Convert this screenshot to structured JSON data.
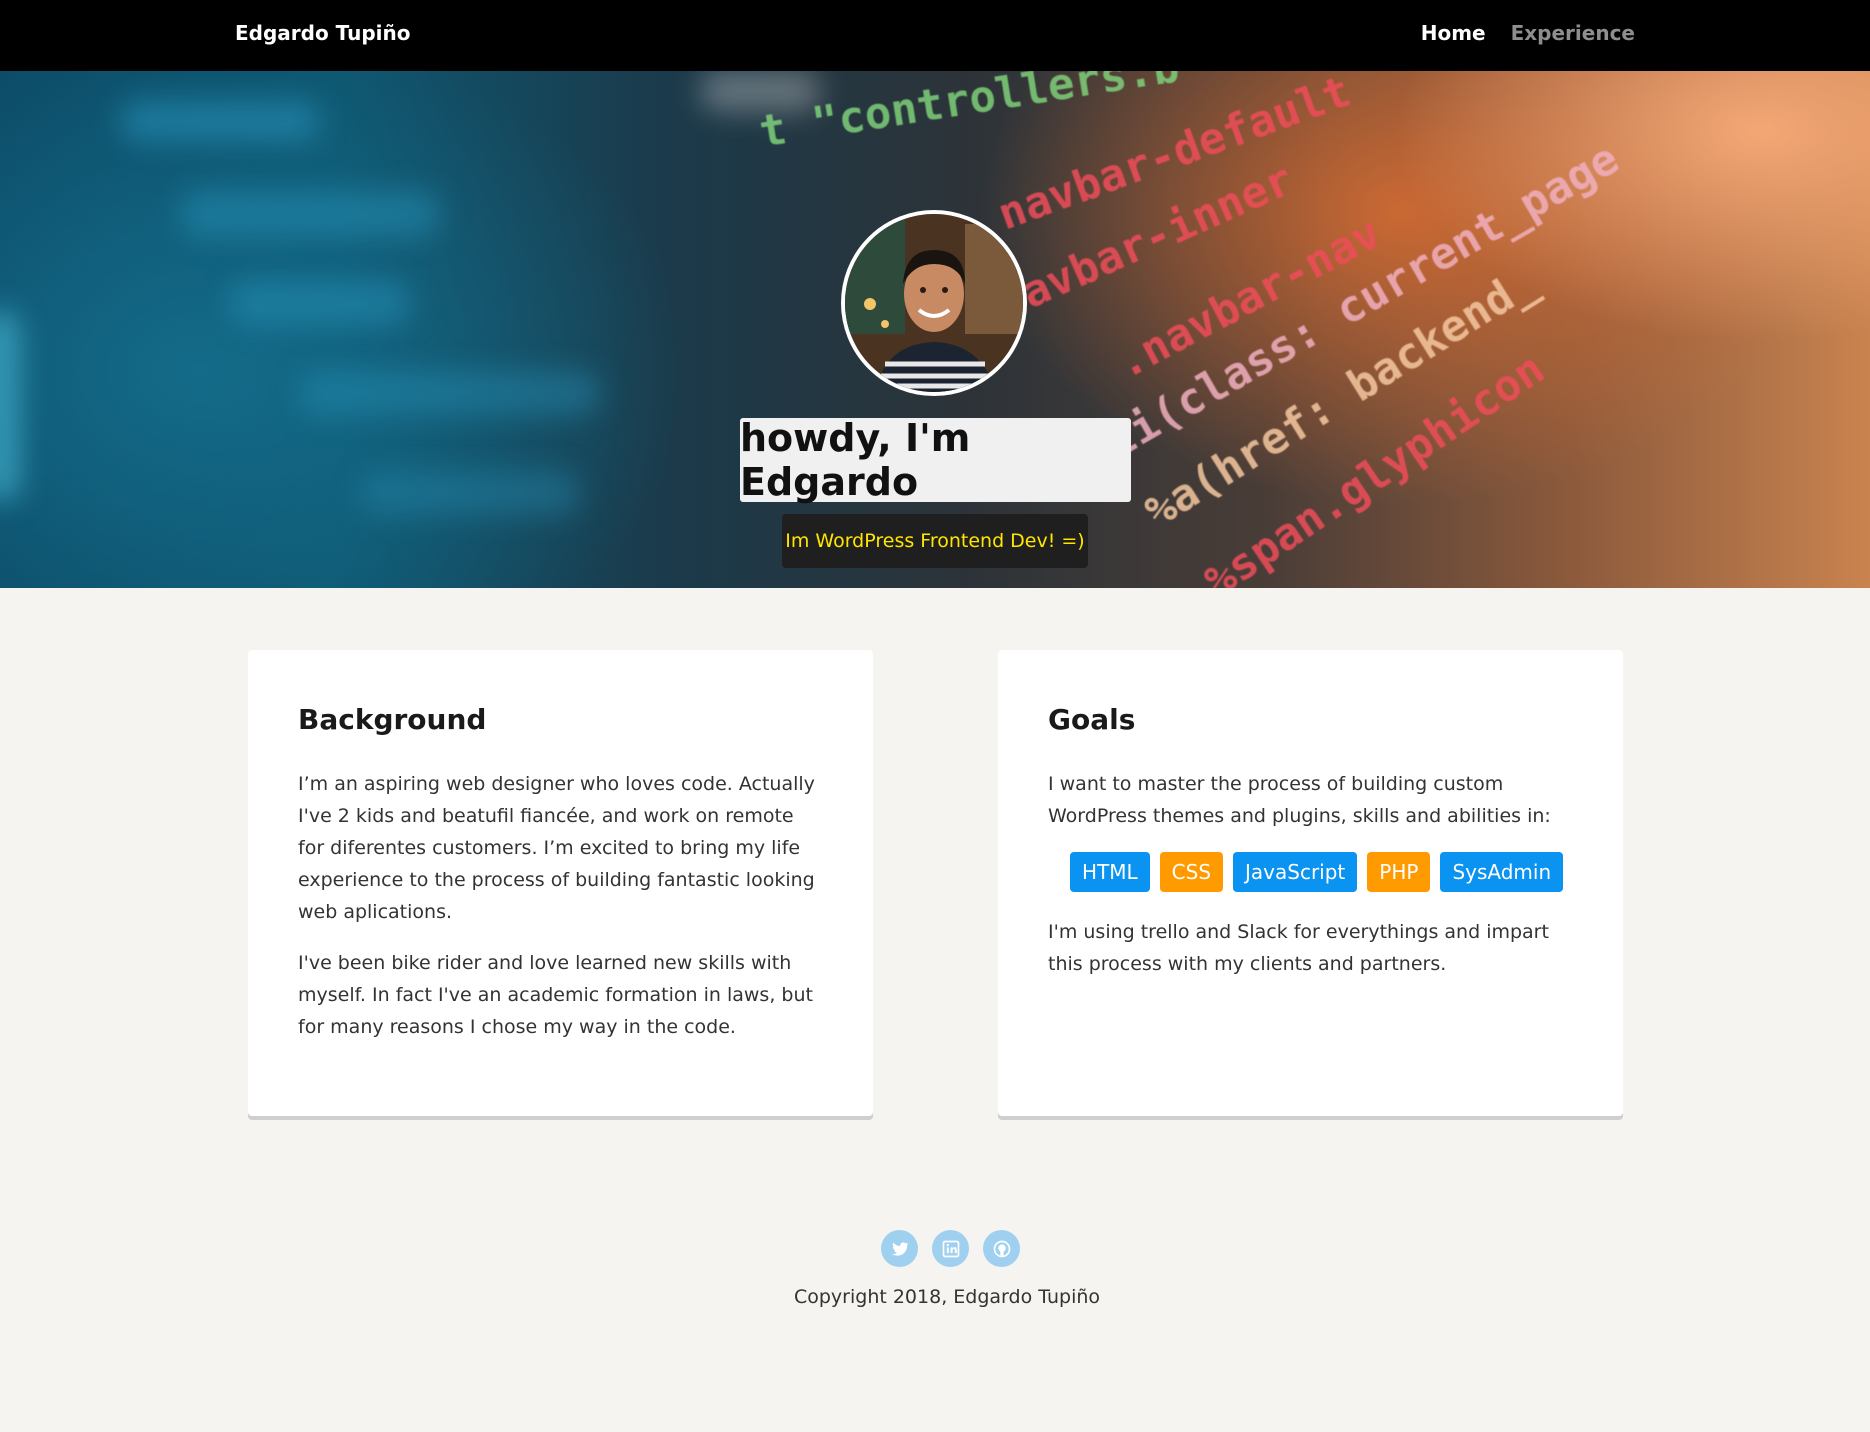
{
  "navbar": {
    "brand": "Edgardo Tupiño",
    "links": [
      {
        "label": "Home",
        "active": true
      },
      {
        "label": "Experience",
        "active": false
      }
    ]
  },
  "hero": {
    "headline": "howdy, I'm Edgardo",
    "tagline": "Im WordPress Frontend Dev! =)",
    "code_lines": [
      "t \"controllers.b",
      "navbar-default",
      "navbar-inner",
      ".navbar-nav",
      "li(class: current_page",
      "%a(href: backend_",
      "%span.glyphicon"
    ],
    "colors": {
      "tagline_text": "#ffe600",
      "tagline_bg": "#1f1f1f",
      "headline_bg": "#f0f0f0"
    }
  },
  "background_card": {
    "title": "Background",
    "paragraphs": [
      "I’m an aspiring web designer who loves code. Actually I've 2 kids and beatufil fiancée, and work on remote for diferentes customers. I’m excited to bring my life experience to the process of building fantastic looking web aplications.",
      "I've been bike rider and love learned new skills with myself. In fact I've an academic formation in laws, but for many reasons I chose my way in the code."
    ]
  },
  "goals_card": {
    "title": "Goals",
    "intro": "I want to master the process of building custom WordPress themes and plugins, skills and abilities in:",
    "skills": [
      {
        "label": "HTML",
        "color": "#0a93f0"
      },
      {
        "label": "CSS",
        "color": "#ff9a00"
      },
      {
        "label": "JavaScript",
        "color": "#0a93f0"
      },
      {
        "label": "PHP",
        "color": "#ff9a00"
      },
      {
        "label": "SysAdmin",
        "color": "#0a93f0"
      }
    ],
    "outro": "I'm using trello and Slack for everythings and impart this process with my clients and partners."
  },
  "footer": {
    "socials": [
      "twitter-icon",
      "linkedin-icon",
      "github-icon"
    ],
    "copyright": "Copyright 2018, Edgardo Tupiño"
  }
}
